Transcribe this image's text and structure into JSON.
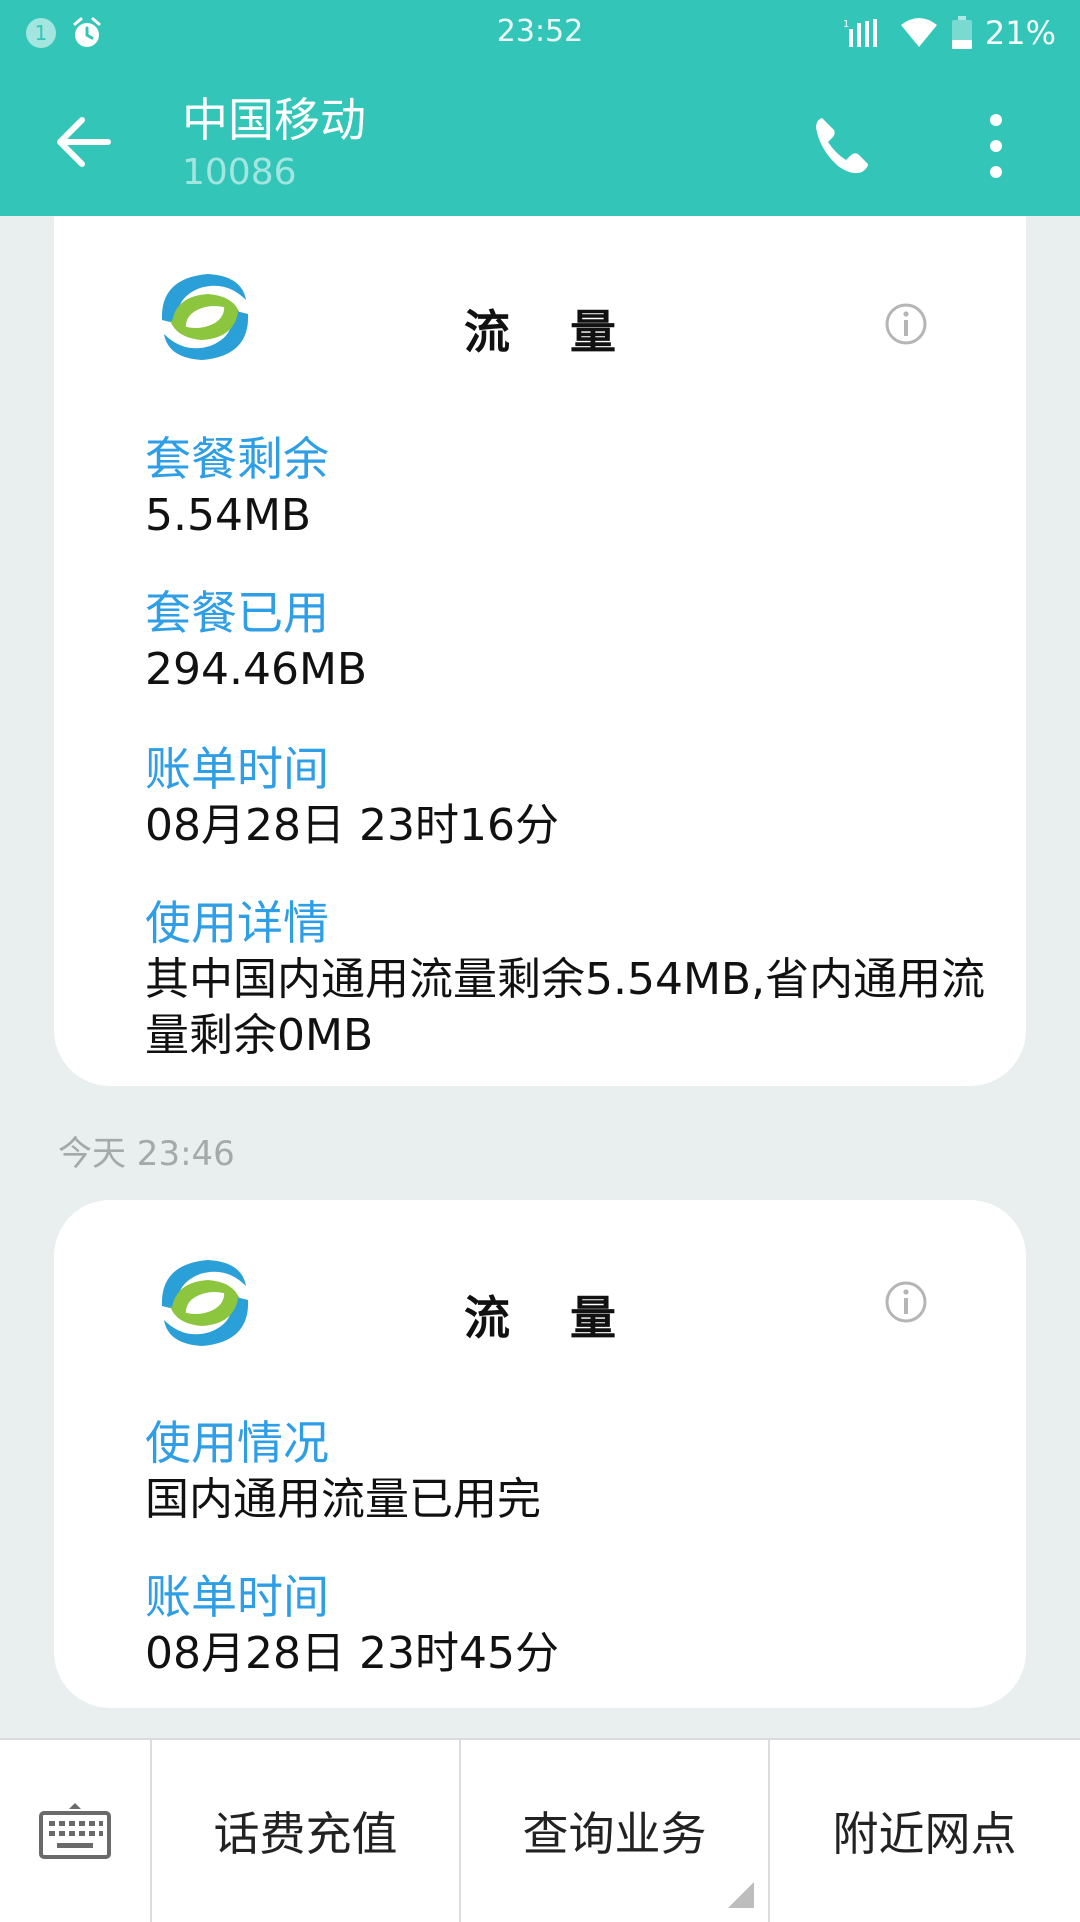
{
  "status_bar": {
    "notification_count": "1",
    "time": "23:52",
    "signal_sim_label": "1",
    "battery_percent": "21%"
  },
  "header": {
    "title": "中国移动",
    "subtitle": "10086",
    "back_icon": "arrow-back-icon",
    "call_icon": "phone-icon",
    "more_icon": "more-vertical-icon"
  },
  "messages": [
    {
      "card_title": "流量",
      "fields": [
        {
          "label": "套餐剩余",
          "value": "5.54MB"
        },
        {
          "label": "套餐已用",
          "value": "294.46MB"
        },
        {
          "label": "账单时间",
          "value": "08月28日  23时16分"
        },
        {
          "label": "使用详情",
          "value": "其中国内通用流量剩余5.54MB,省内通用流量剩余0MB"
        }
      ]
    },
    {
      "timestamp": "今天 23:46",
      "card_title": "流量",
      "fields": [
        {
          "label": "使用情况",
          "value": "国内通用流量已用完"
        },
        {
          "label": "账单时间",
          "value": "08月28日  23时45分"
        }
      ]
    }
  ],
  "bottom_menu": {
    "keyboard_icon": "keyboard-icon",
    "items": [
      "话费充值",
      "查询业务",
      "附近网点"
    ]
  },
  "colors": {
    "accent": "#33c6b8",
    "label_blue": "#2e9ee6",
    "background": "#e9efee"
  }
}
